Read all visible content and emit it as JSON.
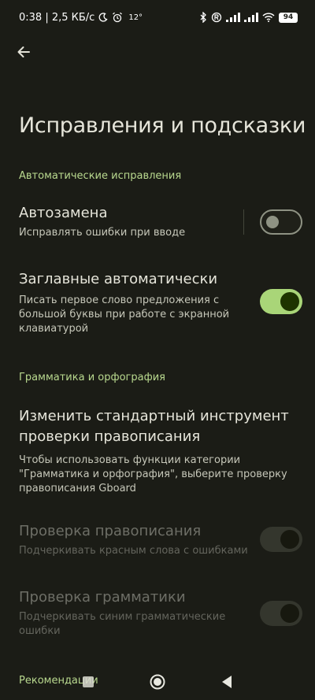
{
  "status_bar": {
    "time_and_speed": "0:38 | 2,5 КБ/с",
    "temperature": "12°",
    "battery": "94"
  },
  "page": {
    "title": "Исправления и подсказки"
  },
  "sections": {
    "auto_correct": {
      "header": "Автоматические исправления",
      "auto_replace": {
        "title": "Автозамена",
        "desc": "Исправлять ошибки при вводе",
        "enabled": false
      },
      "auto_caps": {
        "title": "Заглавные автоматически",
        "desc": "Писать первое слово предложения с большой буквы при работе с экранной клавиатурой",
        "enabled": true
      }
    },
    "grammar": {
      "header": "Грамматика и орфография",
      "change_tool": {
        "title": "Изменить стандартный инструмент проверки правописания",
        "desc": "Чтобы использовать функции категории \"Грамматика и орфография\", выберите проверку правописания Gboard"
      },
      "spell_check": {
        "title": "Проверка правописания",
        "desc": "Подчеркивать красным слова с ошибками",
        "enabled": false,
        "disabled": true
      },
      "grammar_check": {
        "title": "Проверка грамматики",
        "desc": "Подчеркивать синим грамматические ошибки",
        "enabled": false,
        "disabled": true
      }
    },
    "recommendations": {
      "header": "Рекомендации"
    }
  },
  "colors": {
    "background": "#1b1c16",
    "accent_green": "#b9d98f",
    "switch_on": "#a9d578"
  },
  "icons": {
    "back": "arrow-left-icon",
    "home": "circle-home-icon",
    "recent": "square-recent-icon",
    "nav_back": "triangle-back-icon"
  }
}
